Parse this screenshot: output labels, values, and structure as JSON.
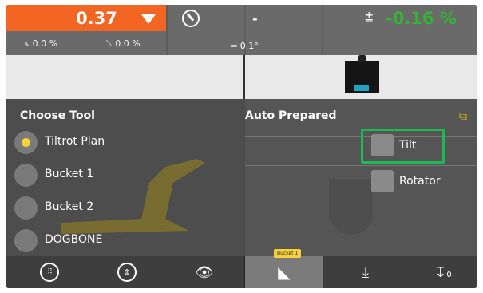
{
  "top_bar": {
    "depth_value": "0.37",
    "cross_slope": "0.0 %",
    "main_slope": "0.0 %",
    "dash_value": "-",
    "angle_value": "0.1°",
    "grade_percent": "-0.16 %",
    "colors": {
      "orange": "#f26522",
      "grade_green": "#35b335"
    }
  },
  "choose_tool": {
    "title": "Choose Tool",
    "options": [
      {
        "label": "Tiltrot Plan",
        "selected": true
      },
      {
        "label": "Bucket 1",
        "selected": false
      },
      {
        "label": "Bucket 2",
        "selected": false
      },
      {
        "label": "DOGBONE",
        "selected": false
      }
    ]
  },
  "auto_prepared": {
    "title": "Auto Prepared",
    "items": [
      {
        "label": "Tilt",
        "highlighted": true
      },
      {
        "label": "Rotator",
        "highlighted": false
      }
    ],
    "highlight_color": "#1db954"
  },
  "bottom_bar": {
    "active_tab_badge": "Bucket 1",
    "icons": [
      "keyboard-icon",
      "info-arrows-icon",
      "excavator-eye-icon",
      "bucket-icon",
      "bucket-lift-icon",
      "down-arrow-zero-icon"
    ]
  }
}
